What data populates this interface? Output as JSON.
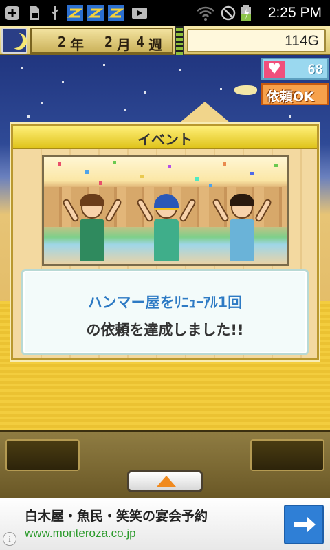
{
  "status_bar": {
    "time": "2:25 PM",
    "icons": [
      "add-icon",
      "sd-card-icon",
      "usb-icon",
      "app-notification-icon",
      "app-notification-icon",
      "app-notification-icon",
      "video-icon",
      "wifi-icon",
      "no-signal-icon",
      "battery-charging-icon"
    ]
  },
  "game": {
    "date": {
      "year": "2",
      "year_unit": "年",
      "month": "2",
      "month_unit": "月",
      "week": "4",
      "week_unit": "週"
    },
    "money": "114G",
    "hearts": "68",
    "request_badge": "依頼OK"
  },
  "event_dialog": {
    "title": "イベント",
    "message_line1": "ハンマー屋をﾘﾆｭｰｱﾙ1回",
    "message_line2": "の依頼を達成しました!!"
  },
  "ad": {
    "title": "白木屋・魚民・笑笑の宴会予約",
    "url": "www.monteroza.co.jp",
    "info_symbol": "i"
  },
  "colors": {
    "accent_gold": "#e0c41c",
    "message_blue": "#2d7ac4",
    "ad_url_green": "#2a9a2a",
    "ad_button_blue": "#2f7fd6"
  }
}
